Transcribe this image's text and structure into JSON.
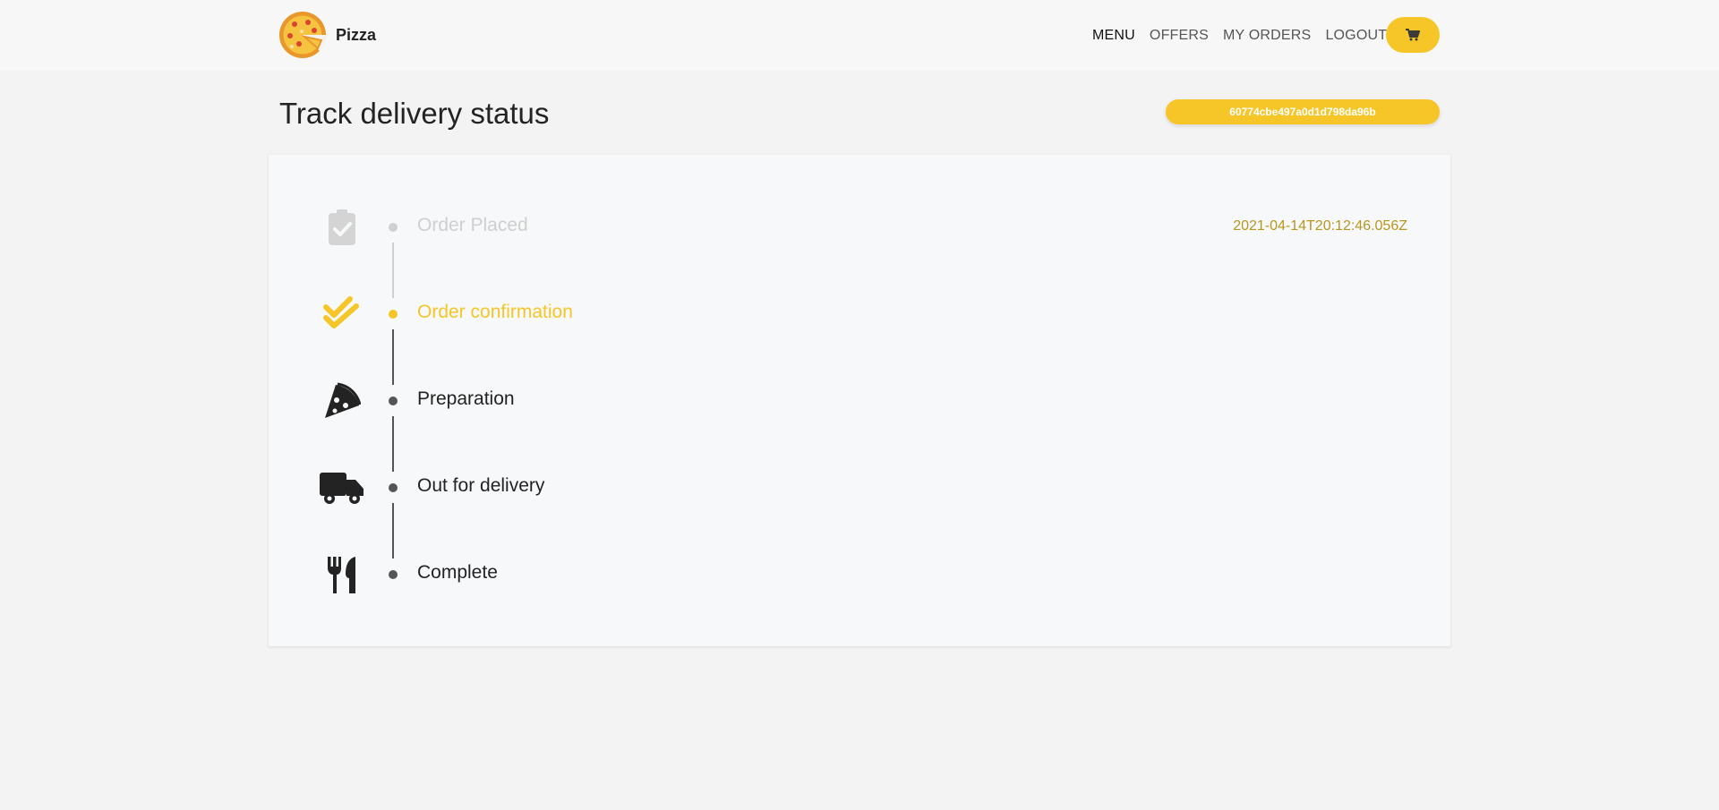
{
  "header": {
    "brand_name": "Pizza",
    "nav": [
      {
        "label": "MENU",
        "active": true
      },
      {
        "label": "OFFERS",
        "active": false
      },
      {
        "label": "MY ORDERS",
        "active": false
      },
      {
        "label": "LOGOUT",
        "active": false
      }
    ],
    "cart_icon": "cart-icon"
  },
  "page": {
    "title": "Track delivery status",
    "order_id": "60774cbe497a0d1d798da96b"
  },
  "steps": [
    {
      "label": "Order Placed",
      "icon": "clipboard-check-icon",
      "state": "done",
      "time": "2021-04-14T20:12:46.056Z"
    },
    {
      "label": "Order confirmation",
      "icon": "double-check-icon",
      "state": "current",
      "time": ""
    },
    {
      "label": "Preparation",
      "icon": "pizza-slice-icon",
      "state": "pending",
      "time": ""
    },
    {
      "label": "Out for delivery",
      "icon": "truck-icon",
      "state": "pending",
      "time": ""
    },
    {
      "label": "Complete",
      "icon": "utensils-icon",
      "state": "pending",
      "time": ""
    }
  ],
  "colors": {
    "accent": "#f6c629",
    "done": "#cfcfcf",
    "pending": "#232323",
    "timestamp": "#b8961f",
    "page_background": "#f3f3f3"
  }
}
